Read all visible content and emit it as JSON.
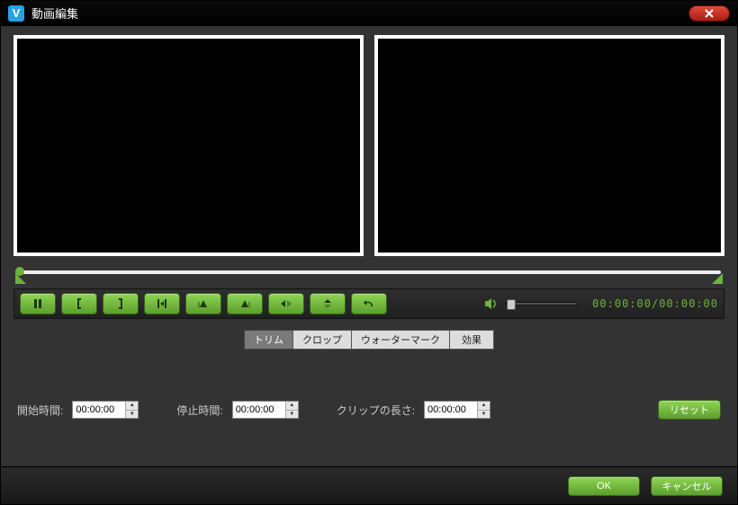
{
  "window": {
    "app_icon_letter": "V",
    "title": "動画編集"
  },
  "playback": {
    "time_current": "00:00:00",
    "time_total": "00:00:00",
    "time_separator": "/"
  },
  "tabs": [
    {
      "id": "trim",
      "label": "トリム",
      "active": true
    },
    {
      "id": "crop",
      "label": "クロップ",
      "active": false
    },
    {
      "id": "watermark",
      "label": "ウォーターマーク",
      "active": false
    },
    {
      "id": "effect",
      "label": "効果",
      "active": false
    }
  ],
  "trim": {
    "start_label": "開始時間:",
    "start_value": "00:00:00",
    "end_label": "停止時間:",
    "end_value": "00:00:00",
    "length_label": "クリップの長さ:",
    "length_value": "00:00:00",
    "reset_label": "リセット"
  },
  "footer": {
    "ok_label": "OK",
    "cancel_label": "キャンセル"
  },
  "colors": {
    "accent_green": "#6db23a",
    "bg": "#333333"
  }
}
